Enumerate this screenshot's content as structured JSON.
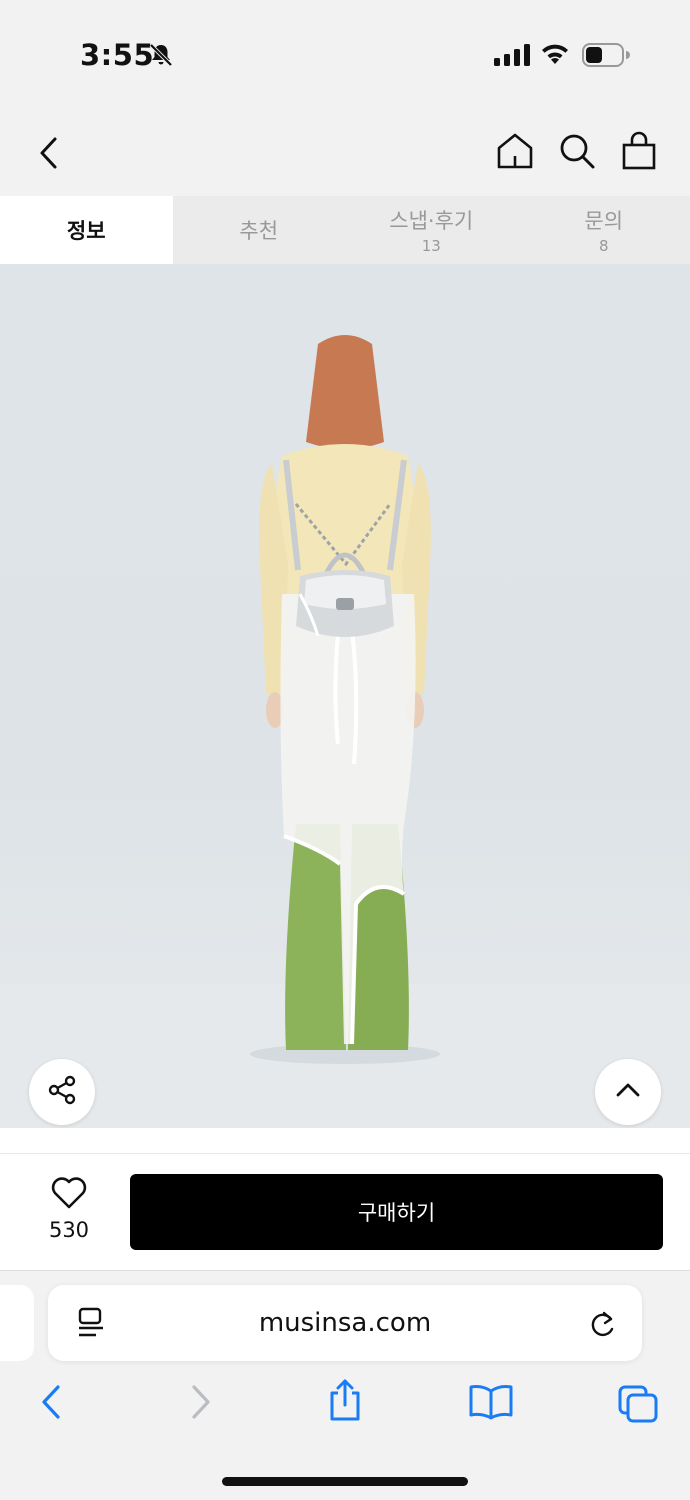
{
  "status_bar": {
    "time": "3:55",
    "icons": [
      "bell-slash-icon",
      "cellular-signal-icon",
      "wifi-icon",
      "battery-icon"
    ]
  },
  "header": {
    "icons": [
      "back-chevron-icon",
      "home-icon",
      "search-icon",
      "shopping-bag-icon"
    ]
  },
  "tabs": [
    {
      "label": "정보",
      "count": "",
      "active": true
    },
    {
      "label": "추천",
      "count": "",
      "active": false
    },
    {
      "label": "스냅·후기",
      "count": "13",
      "active": false
    },
    {
      "label": "문의",
      "count": "8",
      "active": false
    }
  ],
  "product_image": {
    "floating_buttons": [
      "share-icon",
      "scroll-to-top-icon"
    ]
  },
  "action_bar": {
    "like_count": "530",
    "buy_label": "구매하기"
  },
  "browser": {
    "url": "musinsa.com",
    "toolbar_icons": [
      "back-icon",
      "forward-icon",
      "share-icon",
      "bookmarks-icon",
      "tabs-icon"
    ]
  },
  "colors": {
    "accent_blue": "#1a7cf5",
    "buy_button": "#000000",
    "tab_active_bg": "#ffffff",
    "tab_inactive_bg": "#ebebeb"
  }
}
